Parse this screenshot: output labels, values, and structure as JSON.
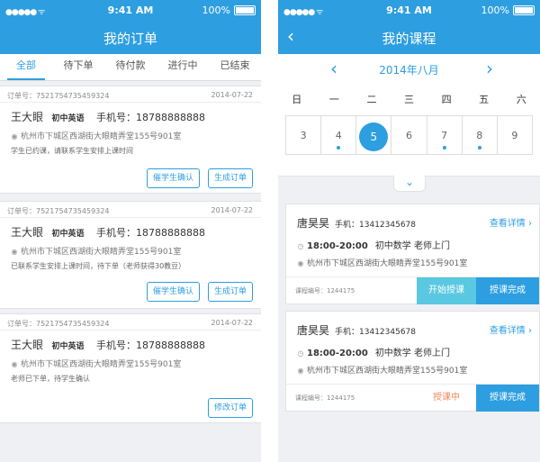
{
  "colors": {
    "accent": "#2d9ee0",
    "start_button": "#5ac8e0",
    "in_progress": "#f08a5d"
  },
  "status_bar": {
    "time": "9:41 AM",
    "battery": "100%"
  },
  "orders_screen": {
    "title": "我的订单",
    "tabs": [
      "全部",
      "待下单",
      "待付款",
      "进行中",
      "已结束"
    ],
    "orders": [
      {
        "order_no": "订单号：7521754735459324",
        "date": "2014-07-22",
        "name": "王大眼",
        "subject": "初中英语",
        "phone": "手机号：18788888888",
        "address": "杭州市下城区西湖街大眼睛弄堂155号901室",
        "note": "学生已约课，请联系学生安排上课时间",
        "buttons": [
          "催学生确认",
          "生成订单"
        ]
      },
      {
        "order_no": "订单号：7521754735459324",
        "date": "2014-07-22",
        "name": "王大眼",
        "subject": "初中英语",
        "phone": "手机号：18788888888",
        "address": "杭州市下城区西湖街大眼睛弄堂155号901室",
        "note": "已联系学生安排上课时间，待下单（老师获得30教豆）",
        "buttons": [
          "催学生确认",
          "生成订单"
        ]
      },
      {
        "order_no": "订单号：7521754735459324",
        "date": "2014-07-22",
        "name": "王大眼",
        "subject": "初中英语",
        "phone": "手机号：18788888888",
        "address": "杭州市下城区西湖街大眼睛弄堂155号901室",
        "note": "老师已下单，待学生确认",
        "buttons": [
          "修改订单"
        ]
      }
    ]
  },
  "courses_screen": {
    "title": "我的课程",
    "month": "2014年八月",
    "weekdays": [
      "日",
      "一",
      "二",
      "三",
      "四",
      "五",
      "六"
    ],
    "days": [
      "3",
      "4",
      "5",
      "6",
      "7",
      "8",
      "9"
    ],
    "selected_day": "5",
    "days_with_class": [
      "4",
      "5",
      "7",
      "8"
    ],
    "courses": [
      {
        "name": "唐昊昊",
        "phone": "手机：13412345678",
        "detail_link": "查看详情",
        "time": "18:00-20:00",
        "subject": "初中数学",
        "mode": "老师上门",
        "address": "杭州市下城区西湖街大眼睛弄堂155号901室",
        "code": "课程编号：1244175",
        "start_label": "开始授课",
        "done_label": "授课完成"
      },
      {
        "name": "唐昊昊",
        "phone": "手机：13412345678",
        "detail_link": "查看详情",
        "time": "18:00-20:00",
        "subject": "初中数学",
        "mode": "老师上门",
        "address": "杭州市下城区西湖街大眼睛弄堂155号901室",
        "code": "课程编号：1244175",
        "status_label": "授课中",
        "done_label": "授课完成"
      }
    ]
  }
}
